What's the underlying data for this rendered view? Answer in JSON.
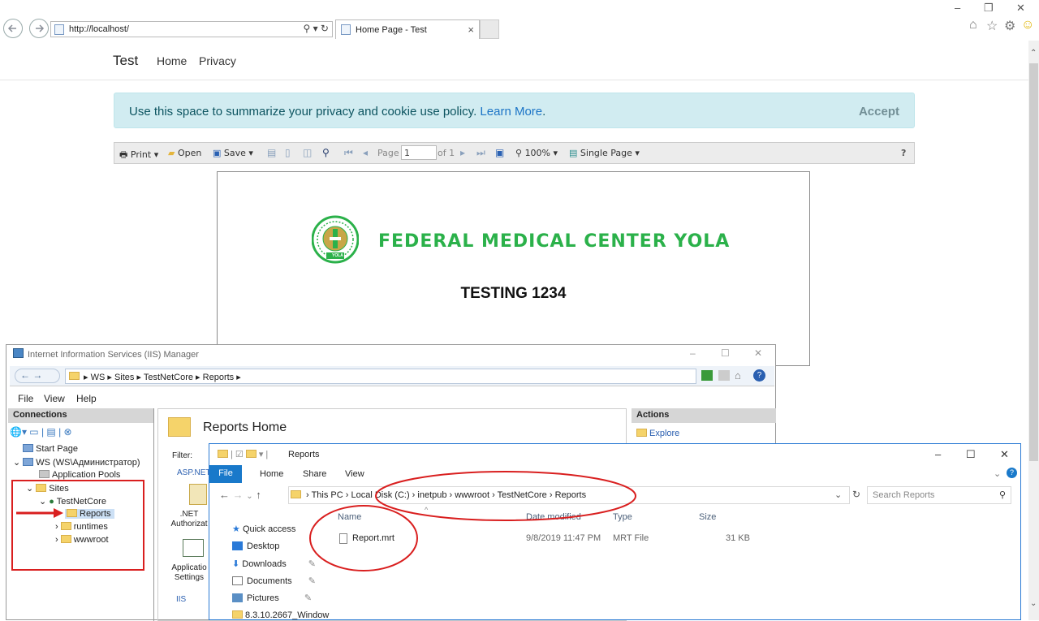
{
  "browser": {
    "url": "http://localhost/",
    "tab_title": "Home Page - Test",
    "tab_close": "×",
    "window_controls": [
      "–",
      "❐",
      "✕"
    ],
    "back_icon": "arrow-left",
    "forward_icon": "arrow-right"
  },
  "site": {
    "brand": "Test",
    "nav": [
      "Home",
      "Privacy"
    ],
    "cookie": {
      "message": "Use this space to summarize your privacy and cookie use policy.",
      "learn_more": "Learn More",
      "period": ".",
      "accept": "Accept"
    }
  },
  "viewer": {
    "print": "Print",
    "open": "Open",
    "save": "Save",
    "page_label": "Page",
    "page_value": "1",
    "of_pages": "of 1",
    "zoom": "100%",
    "mode": "Single Page",
    "help": "?"
  },
  "report": {
    "org": "FEDERAL MEDICAL CENTER YOLA",
    "subtitle": "TESTING 1234",
    "logo_text": "YOLA",
    "accent": "#2bb14a"
  },
  "iis": {
    "title": "Internet Information Services (IIS) Manager",
    "breadcrumb": [
      "WS",
      "Sites",
      "TestNetCore",
      "Reports"
    ],
    "menu": [
      "File",
      "View",
      "Help"
    ],
    "connections": "Connections",
    "tree": {
      "start": "Start Page",
      "server": "WS (WS\\Администратор)",
      "pools": "Application Pools",
      "sites": "Sites",
      "site": "TestNetCore",
      "reports": "Reports",
      "runtimes": "runtimes",
      "wwwroot": "wwwroot"
    },
    "home_title": "Reports Home",
    "filter": "Filter:",
    "group_aspnet": "ASP.NET",
    "feature1": ".NET Authorizat",
    "feature2": "Applicatio Settings",
    "group_iis": "IIS",
    "actions": "Actions",
    "explore": "Explore"
  },
  "explorer": {
    "title": "Reports",
    "tabs": [
      "File",
      "Home",
      "Share",
      "View"
    ],
    "path": [
      "This PC",
      "Local Disk (C:)",
      "inetpub",
      "wwwroot",
      "TestNetCore",
      "Reports"
    ],
    "search_placeholder": "Search Reports",
    "columns": [
      "Name",
      "Date modified",
      "Type",
      "Size"
    ],
    "quick_access": "Quick access",
    "nav": [
      "Desktop",
      "Downloads",
      "Documents",
      "Pictures",
      "8.3.10.2667_Window"
    ],
    "file": {
      "name": "Report.mrt",
      "date": "9/8/2019 11:47 PM",
      "type": "MRT File",
      "size": "31 KB"
    },
    "controls": [
      "–",
      "☐",
      "✕"
    ]
  }
}
